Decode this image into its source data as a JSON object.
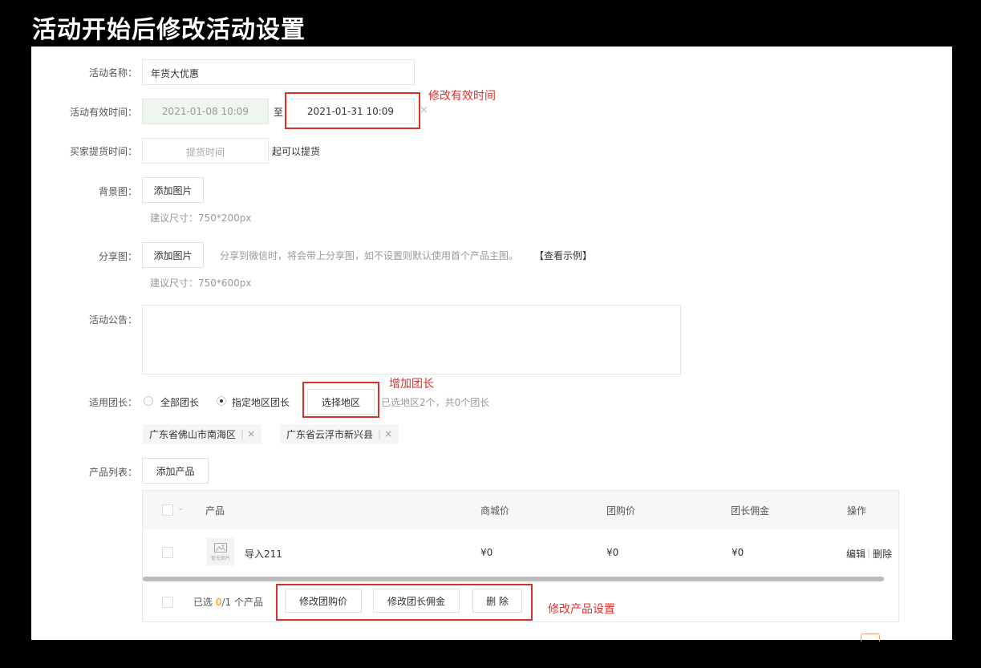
{
  "slide_title": "活动开始后修改活动设置",
  "form": {
    "name_label": "活动名称：",
    "name_value": "年货大优惠",
    "valid_time_label": "活动有效时间：",
    "start_time": "2021-01-08 10:09",
    "to_text": "至",
    "end_time": "2021-01-31 10:09",
    "clear_glyph": "×",
    "pickup_label": "买家提货时间：",
    "pickup_placeholder": "提货时间",
    "pickup_suffix": "起可以提货",
    "bg_label": "背景图：",
    "add_image": "添加图片",
    "bg_size_hint": "建议尺寸：750*200px",
    "share_label": "分享图：",
    "share_hint": "分享到微信时，将会带上分享图，如不设置则默认使用首个产品主图。",
    "share_example": "【查看示例】",
    "share_size_hint": "建议尺寸：750*600px",
    "notice_label": "活动公告：",
    "notice_value": "",
    "leader_label": "适用团长：",
    "radio_all": "全部团长",
    "radio_region": "指定地区团长",
    "select_region": "选择地区",
    "region_summary": "已选地区2个，共0个团长",
    "regions": [
      "广东省佛山市南海区",
      "广东省云浮市新兴县"
    ],
    "product_list_label": "产品列表：",
    "add_product": "添加产品"
  },
  "table": {
    "headers": [
      "产品",
      "商城价",
      "团购价",
      "团长佣金",
      "操作"
    ],
    "rows": [
      {
        "thumb_text": "暂无图片",
        "name": "导入211",
        "mall_price": "¥0",
        "group_price": "¥0",
        "commission": "¥0",
        "edit": "编辑",
        "delete": "删除"
      }
    ],
    "footer": {
      "selected_prefix": "已选 ",
      "selected_count": "0",
      "selected_suffix": "/1 个产品",
      "btn_group_price": "修改团购价",
      "btn_commission": "修改团长佣金",
      "btn_delete": "删 除"
    }
  },
  "annotations": {
    "valid_time": "修改有效时间",
    "leader": "增加团长",
    "products": "修改产品设置"
  },
  "colors": {
    "annotation_red": "#e0302b",
    "disabled_green": "#edf7ee",
    "highlight_orange": "#f08a00"
  }
}
